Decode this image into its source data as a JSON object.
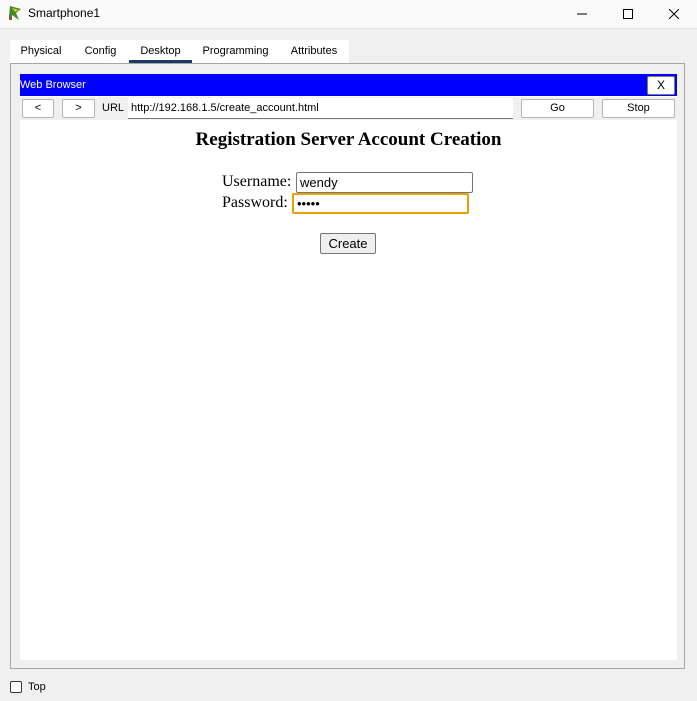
{
  "window": {
    "title": "Smartphone1",
    "app_icon": "packet-tracer-icon",
    "controls": [
      "minimize-icon",
      "maximize-icon",
      "close-icon"
    ]
  },
  "tabs": [
    {
      "label": "Physical",
      "active": false
    },
    {
      "label": "Config",
      "active": false
    },
    {
      "label": "Desktop",
      "active": true
    },
    {
      "label": "Programming",
      "active": false
    },
    {
      "label": "Attributes",
      "active": false
    }
  ],
  "browser": {
    "title": "Web Browser",
    "close_label": "X",
    "back_label": "<",
    "forward_label": ">",
    "url_label": "URL",
    "url_value": "http://192.168.1.5/create_account.html",
    "go_label": "Go",
    "stop_label": "Stop",
    "header_color": "#0000ff"
  },
  "page": {
    "heading": "Registration Server Account Creation",
    "username_label": "Username:",
    "username_value": "wendy",
    "password_label": "Password:",
    "password_value": "•••••",
    "create_label": "Create"
  },
  "footer": {
    "top_label": "Top",
    "top_checked": false
  }
}
